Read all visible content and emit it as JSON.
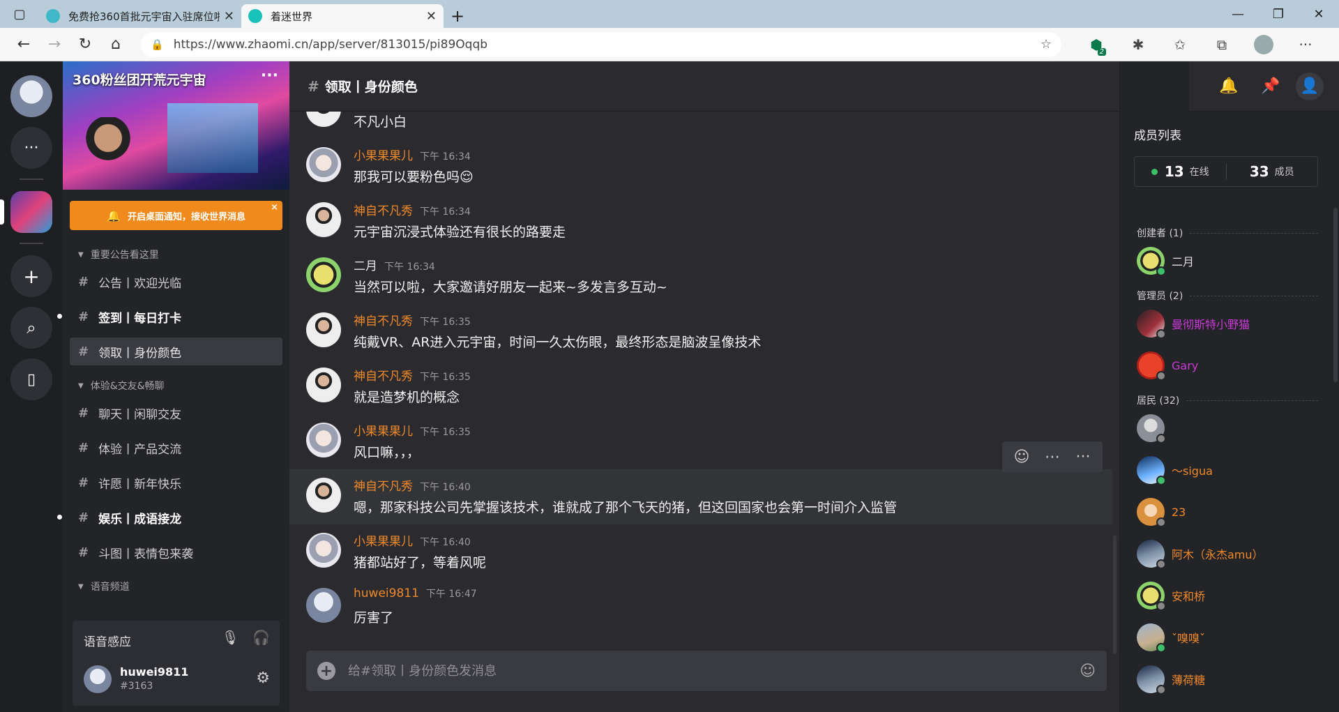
{
  "browser": {
    "tabs": [
      {
        "title": "免费抢360首批元宇宙入驻席位啦",
        "active": false
      },
      {
        "title": "着迷世界",
        "active": true
      }
    ],
    "url": "https://www.zhaomi.cn/app/server/813015/pi89Oqqb",
    "ext_badge": "2"
  },
  "server": {
    "name": "360粉丝团开荒元宇宙",
    "more": "···",
    "notify_text": "开启桌面通知，接收世界消息",
    "notify_close": "×"
  },
  "channels": [
    {
      "kind": "cat",
      "label": "重要公告看这里"
    },
    {
      "kind": "chan",
      "label": "公告丨欢迎光临"
    },
    {
      "kind": "chan",
      "label": "签到丨每日打卡",
      "bold": true,
      "unread": true
    },
    {
      "kind": "chan",
      "label": "领取丨身份颜色",
      "active": true
    },
    {
      "kind": "cat",
      "label": "体验&交友&畅聊"
    },
    {
      "kind": "chan",
      "label": "聊天丨闲聊交友"
    },
    {
      "kind": "chan",
      "label": "体验丨产品交流"
    },
    {
      "kind": "chan",
      "label": "许愿丨新年快乐"
    },
    {
      "kind": "chan",
      "label": "娱乐丨成语接龙",
      "bold": true,
      "unread": true
    },
    {
      "kind": "chan",
      "label": "斗图丨表情包来袭"
    },
    {
      "kind": "cat",
      "label": "语音频道"
    }
  ],
  "voice": {
    "title": "语音感应",
    "user_name": "huwei9811",
    "user_tag": "#3163"
  },
  "main": {
    "channel_name": "领取丨身份颜色",
    "composer_placeholder": "给#领取丨身份颜色发消息"
  },
  "messages": [
    {
      "author": "",
      "time": "",
      "text": "不凡小白",
      "avatar": "man",
      "partial": true
    },
    {
      "author": "小果果果儿",
      "time": "下午 16:34",
      "text": "那我可以要粉色吗😌",
      "avatar": "girl"
    },
    {
      "author": "神自不凡秀",
      "time": "下午 16:34",
      "text": "元宇宙沉浸式体验还有很长的路要走",
      "avatar": "man"
    },
    {
      "author": "二月",
      "time": "下午 16:34",
      "text": "当然可以啦，大家邀请好朋友一起来~多发言多互动~",
      "avatar": "er",
      "plain": true
    },
    {
      "author": "神自不凡秀",
      "time": "下午 16:35",
      "text": "纯戴VR、AR进入元宇宙，时间一久太伤眼，最终形态是脑波呈像技术",
      "avatar": "man"
    },
    {
      "author": "神自不凡秀",
      "time": "下午 16:35",
      "text": "就是造梦机的概念",
      "avatar": "man"
    },
    {
      "author": "小果果果儿",
      "time": "下午 16:35",
      "text": "风口嘛，，，",
      "avatar": "girl"
    },
    {
      "author": "神自不凡秀",
      "time": "下午 16:40",
      "text": "嗯，那家科技公司先掌握该技术，谁就成了那个飞天的猪，但这回国家也会第一时间介入监管",
      "avatar": "man",
      "hover": true
    },
    {
      "author": "小果果果儿",
      "time": "下午 16:40",
      "text": "猪都站好了，等着风呢",
      "avatar": "girl"
    },
    {
      "author": "huwei9811",
      "time": "下午 16:47",
      "text": "厉害了",
      "avatar": "me"
    }
  ],
  "members": {
    "title": "成员列表",
    "online_count": "13",
    "online_label": "在线",
    "total_count": "33",
    "total_label": "成员",
    "sections": [
      {
        "label": "创建者 (1)",
        "items": [
          {
            "name": "二月",
            "color": "#e0e0e0",
            "av": "er",
            "online": true
          }
        ]
      },
      {
        "label": "管理员 (2)",
        "items": [
          {
            "name": "曼彻斯特小野猫",
            "color": "#c93ad6",
            "av": "dark",
            "online": false
          },
          {
            "name": "Gary",
            "color": "#c93ad6",
            "av": "red",
            "online": false
          }
        ]
      },
      {
        "label": "居民 (32)",
        "items": [
          {
            "name": "",
            "color": "#f0892a",
            "av": "gray",
            "online": false
          },
          {
            "name": "～sigua",
            "color": "#f0892a",
            "av": "blue",
            "online": true
          },
          {
            "name": "23",
            "color": "#f0892a",
            "av": "anime",
            "online": false
          },
          {
            "name": "阿木（永杰amu）",
            "color": "#f0892a",
            "av": "sky",
            "online": false
          },
          {
            "name": "安和桥",
            "color": "#f0892a",
            "av": "er",
            "online": false
          },
          {
            "name": "ˇ嗅嗅ˇ",
            "color": "#f0892a",
            "av": "land",
            "online": true
          },
          {
            "name": "薄荷糖",
            "color": "#f0892a",
            "av": "sky",
            "online": false
          }
        ]
      }
    ]
  }
}
